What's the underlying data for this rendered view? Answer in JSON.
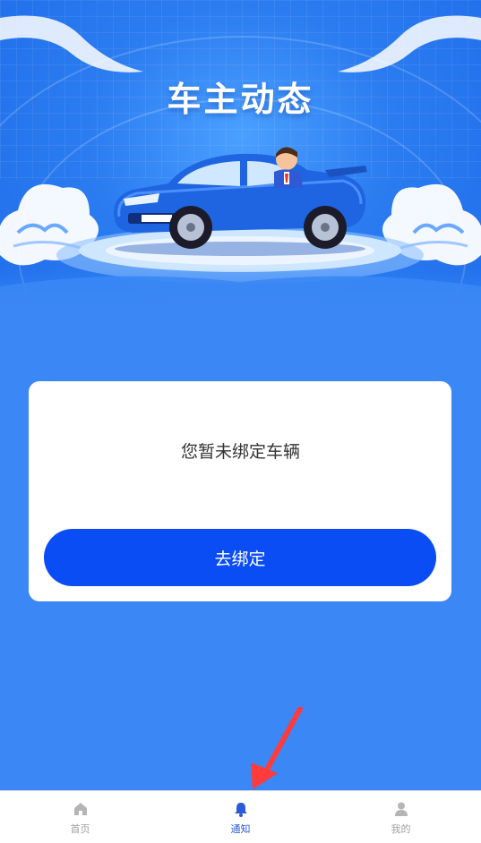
{
  "hero": {
    "title": "车主动态",
    "illustration": "car-with-driver"
  },
  "card": {
    "message": "您暂未绑定车辆",
    "button_label": "去绑定"
  },
  "tabbar": {
    "items": [
      {
        "label": "首页",
        "icon": "home-icon",
        "active": false
      },
      {
        "label": "通知",
        "icon": "bell-icon",
        "active": true
      },
      {
        "label": "我的",
        "icon": "user-icon",
        "active": false
      }
    ]
  },
  "colors": {
    "background": "#3a87f5",
    "button": "#0a4df5",
    "tab_active": "#2c5bd8",
    "tab_inactive": "#a0a0a0",
    "annotation_arrow": "#ff3b3b"
  }
}
